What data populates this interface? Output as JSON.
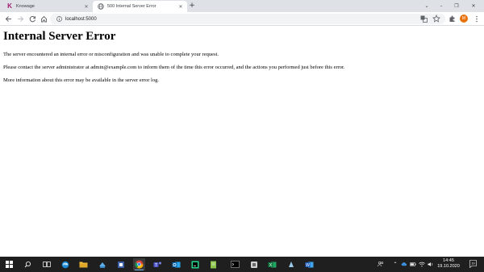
{
  "browser": {
    "tabs": [
      {
        "title": "Knowage",
        "favicon": "knowage-k-icon",
        "favicon_letter": "K",
        "favicon_color": "#a3196e",
        "active": false
      },
      {
        "title": "500 Internal Server Error",
        "favicon": "globe-icon",
        "active": true
      }
    ],
    "new_tab_symbol": "+",
    "url": "localhost:5000",
    "profile_initial": "M",
    "profile_color": "#e8710a"
  },
  "page": {
    "heading": "Internal Server Error",
    "paragraphs": [
      "The server encountered an internal error or misconfiguration and was unable to complete your request.",
      "Please contact the server administrator at admin@example.com to inform them of the time this error occurred, and the actions you performed just before this error.",
      "More information about this error may be available in the server error log."
    ]
  },
  "taskbar": {
    "apps": [
      "start-icon",
      "search-icon",
      "task-view-icon",
      "edge-icon",
      "file-explorer-icon",
      "app-icon",
      "app-icon",
      "chrome-icon",
      "teams-icon",
      "outlook-icon",
      "pycharm-icon",
      "notepad-icon",
      "terminal-icon",
      "app-icon",
      "excel-icon",
      "app-icon",
      "word-icon"
    ],
    "time": "14:45",
    "date": "19.10.2020",
    "notification_count": "19"
  }
}
